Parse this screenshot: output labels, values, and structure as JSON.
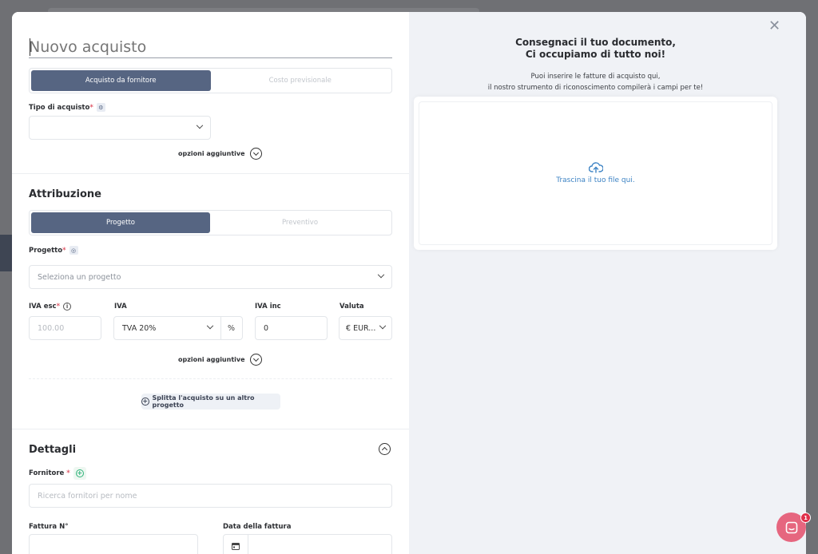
{
  "header": {
    "title_placeholder": "Nuovo acquisto"
  },
  "purchase_type_tabs": [
    {
      "label": "Acquisto da fornitore",
      "active": true
    },
    {
      "label": "Costo previsionale",
      "active": false
    }
  ],
  "purchase_type": {
    "label": "Tipo di acquisto",
    "required_mark": "*",
    "icon": "gear-icon",
    "value": ""
  },
  "more_options_1": {
    "label": "opzioni aggiuntive"
  },
  "attribution": {
    "title": "Attribuzione",
    "tabs": [
      {
        "label": "Progetto",
        "active": true
      },
      {
        "label": "Preventivo",
        "active": false
      }
    ],
    "project_label": "Progetto",
    "required_mark": "*",
    "project_placeholder": "Seleziona un progetto",
    "iva_esc_label": "IVA esc",
    "iva_esc_placeholder": "100.00",
    "iva_label": "IVA",
    "iva_value": "TVA 20%",
    "iva_unit": "%",
    "iva_inc_label": "IVA inc",
    "iva_inc_value": "0",
    "currency_label": "Valuta",
    "currency_value": "€ EUR...",
    "more_options": "opzioni aggiuntive",
    "split_label": "Splitta l'acquisto su un altro progetto"
  },
  "details": {
    "title": "Dettagli",
    "supplier_label": "Fornitore",
    "required_mark": "*",
    "supplier_placeholder": "Ricerca fornitori per nome",
    "invoice_no_label": "Fattura N°",
    "invoice_date_label": "Data della fattura"
  },
  "upload": {
    "title_line1": "Consegnaci il tuo documento,",
    "title_line2": "Ci occupiamo di tutto noi!",
    "sub_line1": "Puoi inserire le fatture di acquisto qui,",
    "sub_line2": "il nostro strumento di riconoscimento compilerà i campi per te!",
    "drop_text": "Trascina il tuo file qui."
  },
  "chat": {
    "badge_count": "1"
  },
  "colors": {
    "accent": "#566582",
    "link": "#3d83c4",
    "chat": "#e6667f",
    "required": "#e05b6a"
  }
}
